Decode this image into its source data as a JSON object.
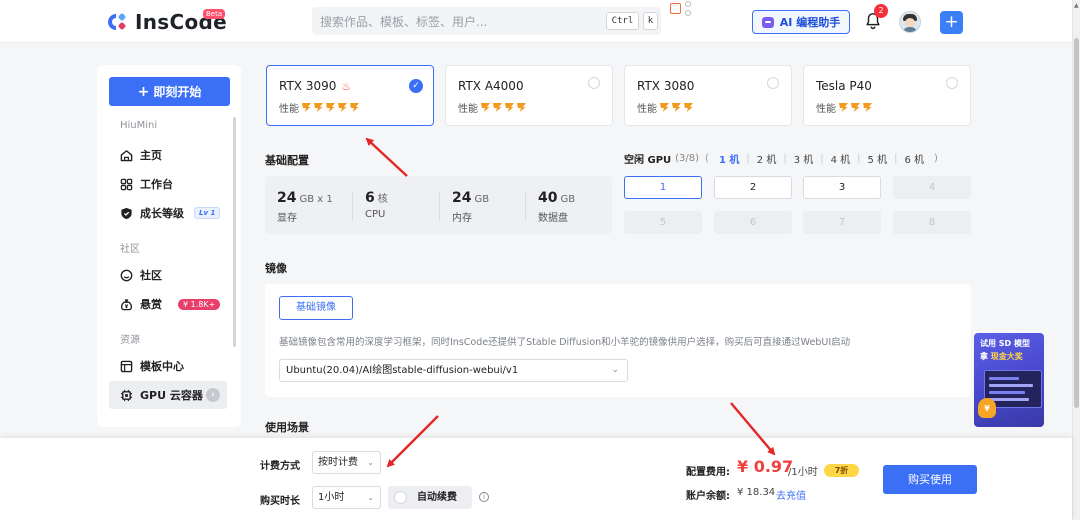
{
  "header": {
    "logo_text": "InsCode",
    "beta_badge": "Beta",
    "search_placeholder": "搜索作品、模板、标签、用户...",
    "kbd_ctrl": "Ctrl",
    "kbd_k": "k",
    "ai_assistant_label": "AI 编程助手",
    "notification_count": "2",
    "plus_label": "+"
  },
  "sidebar": {
    "start_button": "即刻开始",
    "start_plus": "+",
    "sections": {
      "hiumini": "HiuMini",
      "community": "社区",
      "resources": "资源"
    },
    "items": [
      {
        "label": "主页",
        "icon": "home-icon"
      },
      {
        "label": "工作台",
        "icon": "grid-icon"
      },
      {
        "label": "成长等级",
        "icon": "shield-icon",
        "badge": "Lv 1"
      },
      {
        "label": "社区",
        "icon": "smile-icon"
      },
      {
        "label": "悬赏",
        "icon": "money-bag-icon",
        "badge": "¥ 1.8K+"
      },
      {
        "label": "模板中心",
        "icon": "template-icon"
      },
      {
        "label": "GPU 云容器",
        "icon": "chip-icon",
        "active": true
      }
    ]
  },
  "gpus": [
    {
      "name": "RTX 3090",
      "perf_label": "性能",
      "perf_level": 5,
      "hot": true,
      "selected": true
    },
    {
      "name": "RTX A4000",
      "perf_label": "性能",
      "perf_level": 4,
      "hot": false,
      "selected": false
    },
    {
      "name": "RTX 3080",
      "perf_label": "性能",
      "perf_level": 3,
      "hot": false,
      "selected": false
    },
    {
      "name": "Tesla P40",
      "perf_label": "性能",
      "perf_level": 3,
      "hot": false,
      "selected": false
    }
  ],
  "basic_config": {
    "title": "基础配置",
    "specs": [
      {
        "value": "24",
        "unit": "GB x 1",
        "label": "显存"
      },
      {
        "value": "6",
        "unit": "核",
        "label": "CPU"
      },
      {
        "value": "24",
        "unit": "GB",
        "label": "内存"
      },
      {
        "value": "40",
        "unit": "GB",
        "label": "数据盘"
      }
    ]
  },
  "gpu_availability": {
    "title": "空闲 GPU",
    "count": "(3/8)",
    "paren_open": "(",
    "paren_close": ")",
    "options": [
      "1 机",
      "2 机",
      "3 机",
      "4 机",
      "5 机",
      "6 机"
    ],
    "selected_option": "1 机",
    "boxes": [
      "1",
      "2",
      "3",
      "4",
      "5",
      "6",
      "7",
      "8"
    ],
    "available": 3,
    "selected_box": "1"
  },
  "mirror": {
    "title": "镜像",
    "tab_label": "基础镜像",
    "description": "基础镜像包含常用的深度学习框架，同时InsCode还提供了Stable Diffusion和小羊驼的镜像供用户选择，购买后可直接通过WebUI启动",
    "selected_image": "Ubuntu(20.04)/AI绘图stable-diffusion-webui/v1"
  },
  "usage": {
    "title": "使用场景"
  },
  "promo": {
    "line1": "试用 SD 模型",
    "line2_prefix": "拿 ",
    "line2_highlight": "现金大奖",
    "coin_symbol": "¥"
  },
  "billing": {
    "method_label": "计费方式",
    "method_value": "按时计费",
    "duration_label": "购买时长",
    "duration_value": "1小时",
    "auto_renew_label": "自动续费",
    "info_glyph": "i",
    "fee_label": "配置费用:",
    "fee_value": "¥ 0.97",
    "fee_unit": "/1小时",
    "discount_badge": "7折",
    "balance_label": "账户余额:",
    "balance_value": "¥ 18.34",
    "recharge_link": "去充值",
    "buy_button": "购买使用"
  },
  "colors": {
    "accent": "#3b6ff5",
    "price_red": "#f0403d",
    "bolt_orange": "#f29a1d",
    "annotation_red": "#e32626"
  }
}
